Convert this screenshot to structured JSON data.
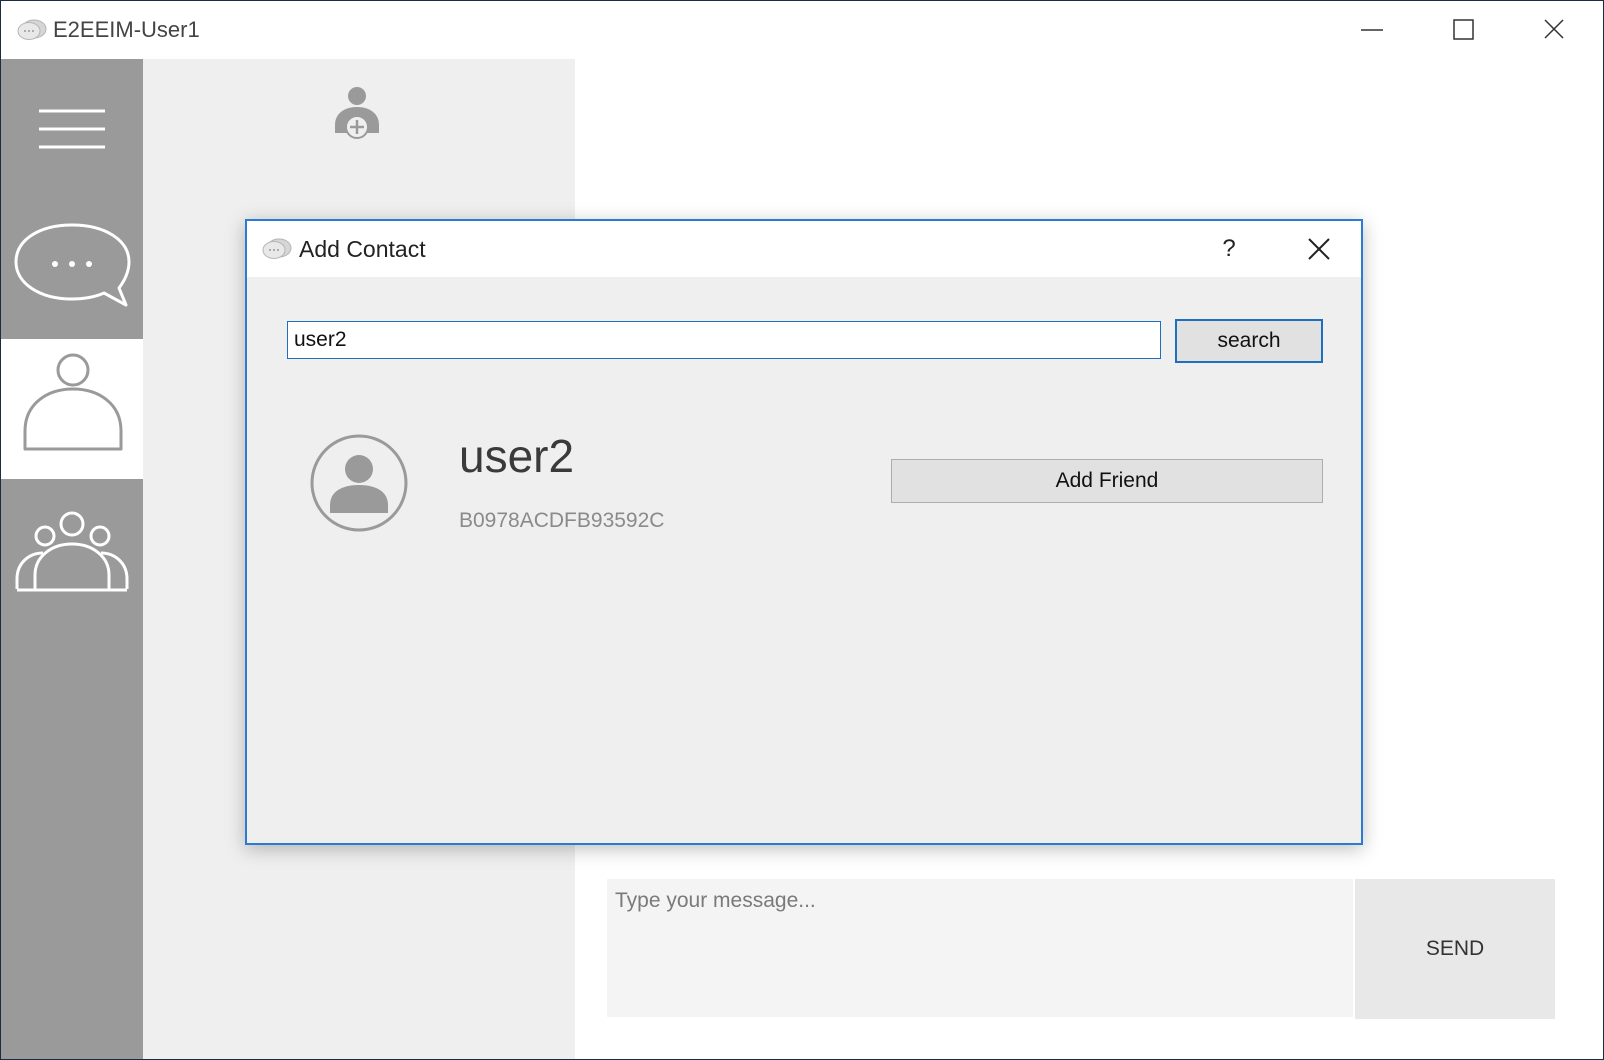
{
  "window": {
    "title": "E2EEIM-User1"
  },
  "sidebar": {
    "items": [
      {
        "name": "menu",
        "icon": "hamburger-menu-icon"
      },
      {
        "name": "chats",
        "icon": "chat-bubble-icon"
      },
      {
        "name": "contacts",
        "icon": "person-icon",
        "active": true
      },
      {
        "name": "groups",
        "icon": "group-icon"
      }
    ]
  },
  "contacts_panel": {
    "icon": "add-contact-icon"
  },
  "chat": {
    "message_placeholder": "Type your message...",
    "send_label": "SEND"
  },
  "dialog": {
    "title": "Add Contact",
    "help_label": "?",
    "search_value": "user2",
    "search_button_label": "search",
    "result": {
      "username": "user2",
      "key_id": "B0978ACDFB93592C"
    },
    "add_friend_label": "Add Friend"
  },
  "colors": {
    "sidebar": "#9a9a9a",
    "panel": "#efefef",
    "accent": "#2b7bd0"
  }
}
